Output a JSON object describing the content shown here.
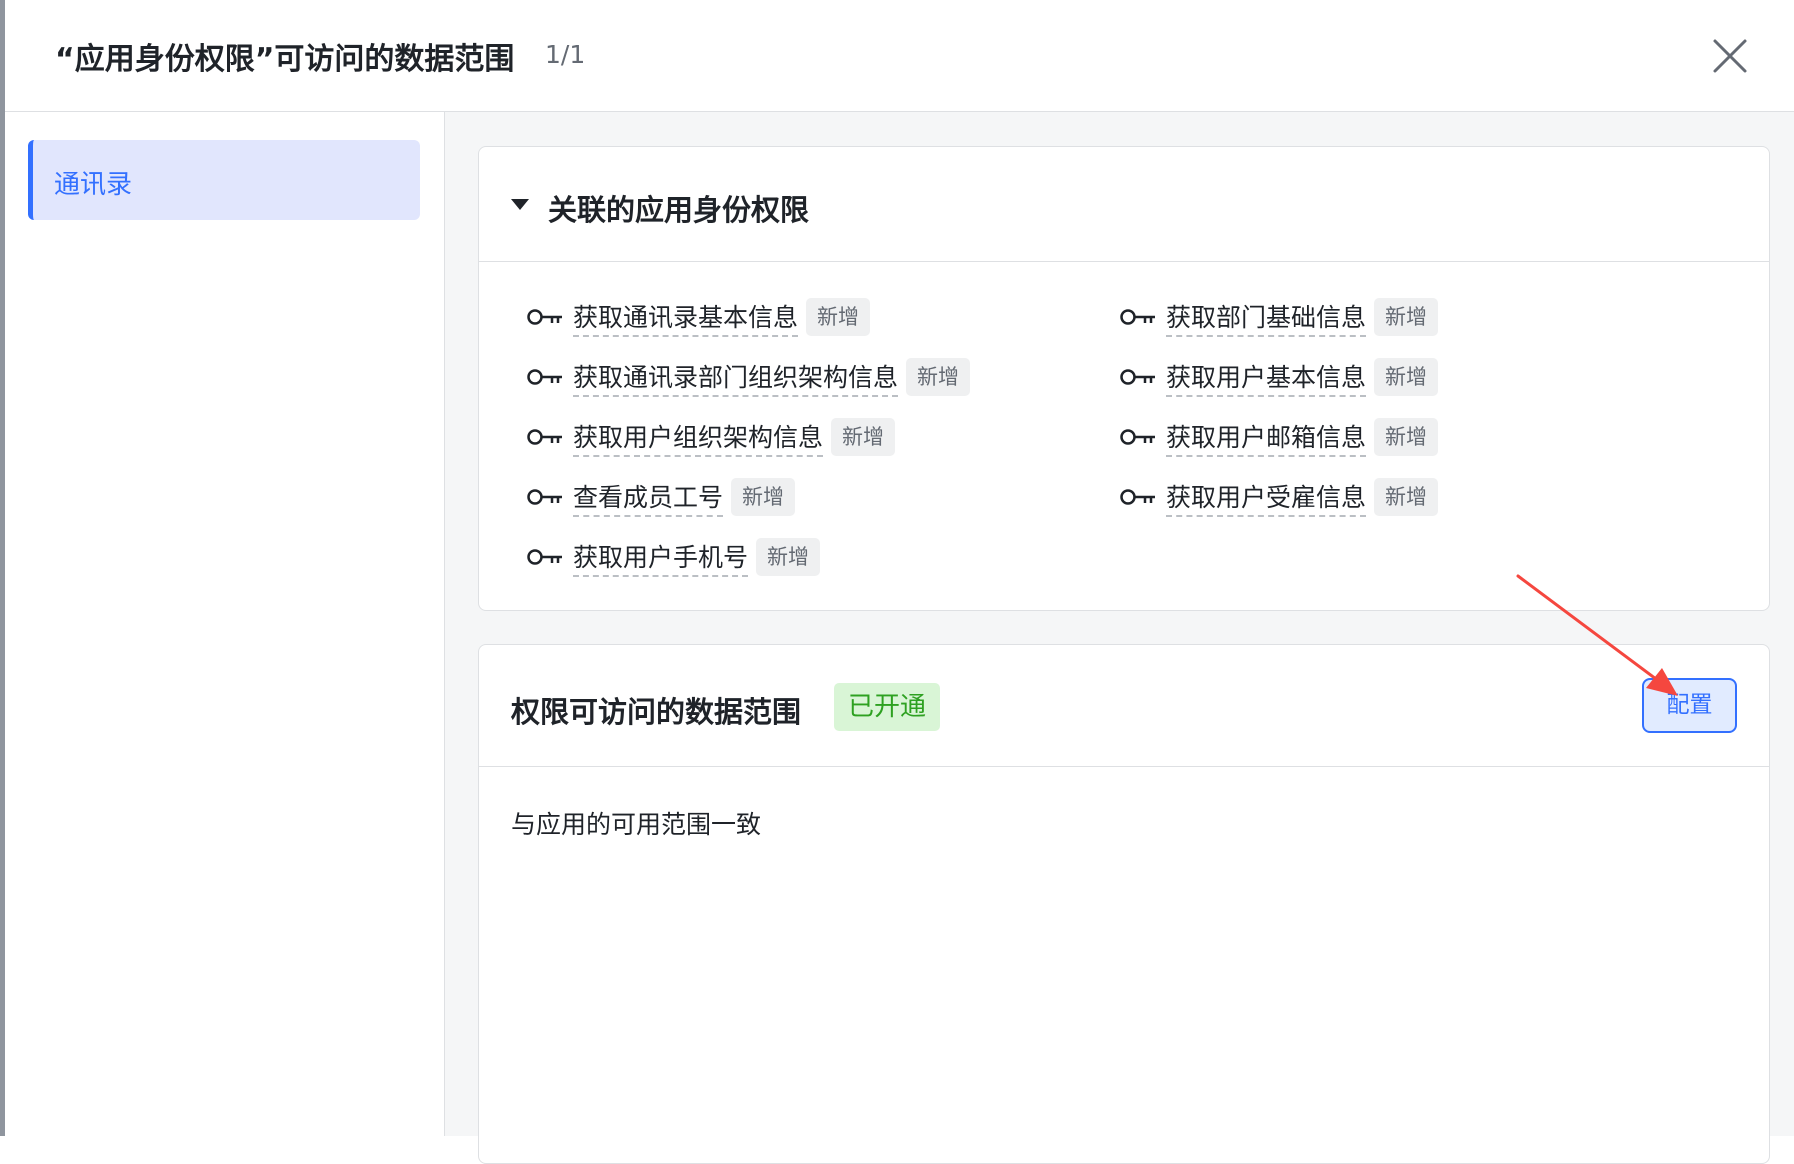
{
  "header": {
    "title": "“应用身份权限”可访问的数据范围",
    "counter": "1/1"
  },
  "sidebar": {
    "items": [
      {
        "label": "通讯录"
      }
    ]
  },
  "permissions_section": {
    "title": "关联的应用身份权限",
    "new_tag": "新增",
    "left": [
      "获取通讯录基本信息",
      "获取通讯录部门组织架构信息",
      "获取用户组织架构信息",
      "查看成员工号",
      "获取用户手机号"
    ],
    "right": [
      "获取部门基础信息",
      "获取用户基本信息",
      "获取用户邮箱信息",
      "获取用户受雇信息"
    ]
  },
  "scope_section": {
    "title": "权限可访问的数据范围",
    "status": "已开通",
    "config_label": "配置",
    "description": "与应用的可用范围一致"
  },
  "colors": {
    "accent": "#3370ff",
    "status_green": "#2ea121",
    "annotation_arrow": "#f5473f"
  }
}
